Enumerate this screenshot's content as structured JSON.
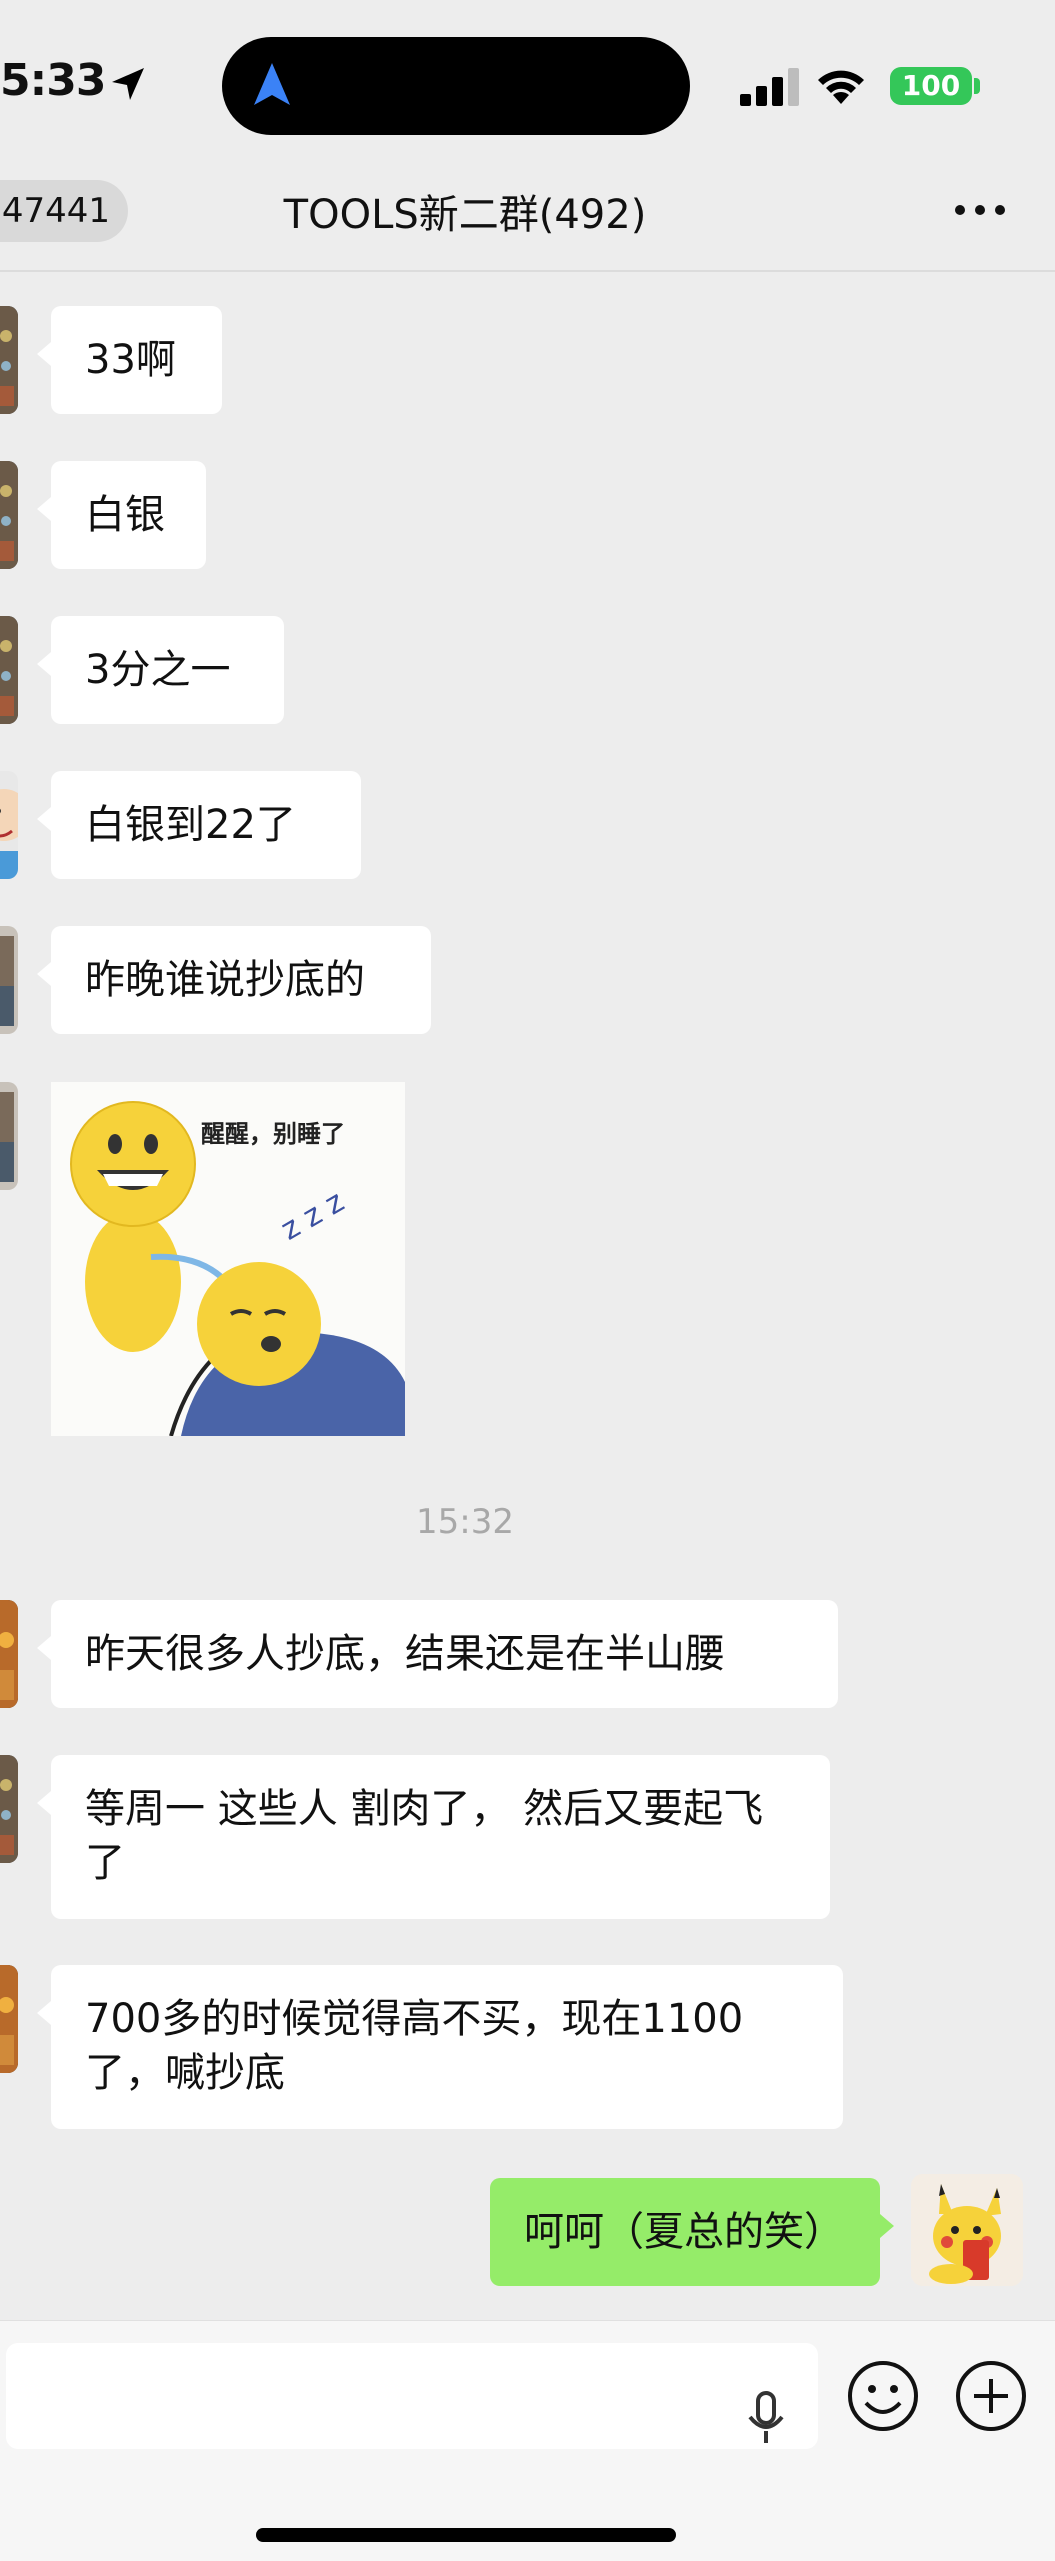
{
  "status_bar": {
    "time": "5:33",
    "battery": "100"
  },
  "nav": {
    "back_count": "47441",
    "title": "TOOLS新二群(492)"
  },
  "messages": [
    {
      "text": "33啊"
    },
    {
      "text": "白银"
    },
    {
      "text": "3分之一"
    },
    {
      "text": "白银到22了"
    },
    {
      "text": "昨晚谁说抄底的"
    },
    {
      "text": "昨天很多人抄底，结果还是在半山腰"
    },
    {
      "text": "等周一 这些人 割肉了， 然后又要起飞了"
    },
    {
      "text": "700多的时候觉得高不买，现在1100了，喊抄底"
    }
  ],
  "sticker": {
    "caption": "醒醒，别睡了",
    "zzz": "z z z"
  },
  "timestamp": "15:32",
  "my_message": {
    "text": "呵呵（夏总的笑）"
  },
  "colors": {
    "my_bubble": "#95ec69",
    "background": "#ededed",
    "battery": "#34c759"
  }
}
